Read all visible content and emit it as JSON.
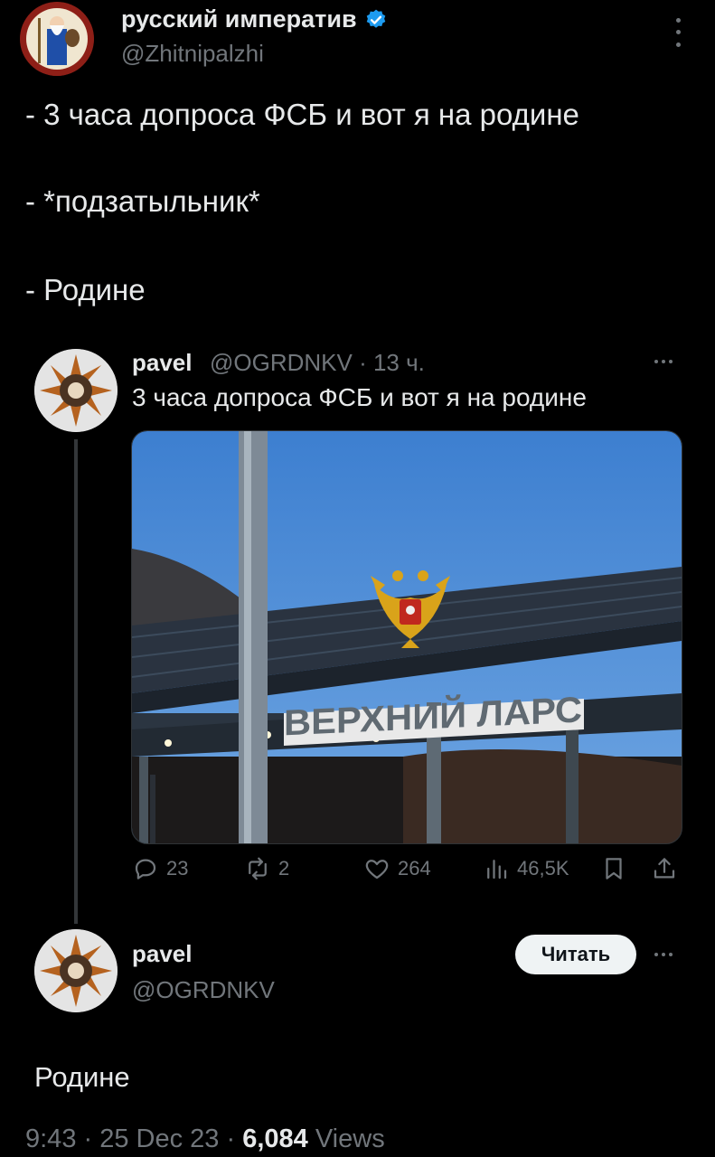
{
  "main_post": {
    "author_name": "русский императив",
    "author_handle": "@Zhitnipalzhi",
    "lines": [
      "- 3 часа допроса ФСБ и вот я на родине",
      "- *подзатыльник*",
      "- Родине"
    ]
  },
  "quoted_post": {
    "author_name": "pavel",
    "author_handle": "@OGRDNKV",
    "time": "· 13 ч.",
    "text": "3 часа допроса ФСБ и вот я на родине",
    "image_sign": "ВЕРХНИЙ ЛАРС",
    "stats": {
      "replies": "23",
      "reposts": "2",
      "likes": "264",
      "views": "46,5K"
    }
  },
  "reply_card": {
    "author_name": "pavel",
    "author_handle": "@OGRDNKV",
    "read_button": "Читать",
    "text": "Родине"
  },
  "footer": {
    "time": "9:43",
    "date": "25 Dec 23",
    "views_count": "6,084",
    "views_label": "Views"
  },
  "colors": {
    "background": "#000000",
    "text": "#e7e9ea",
    "muted": "#71767b",
    "verified": "#1d9bf0"
  }
}
